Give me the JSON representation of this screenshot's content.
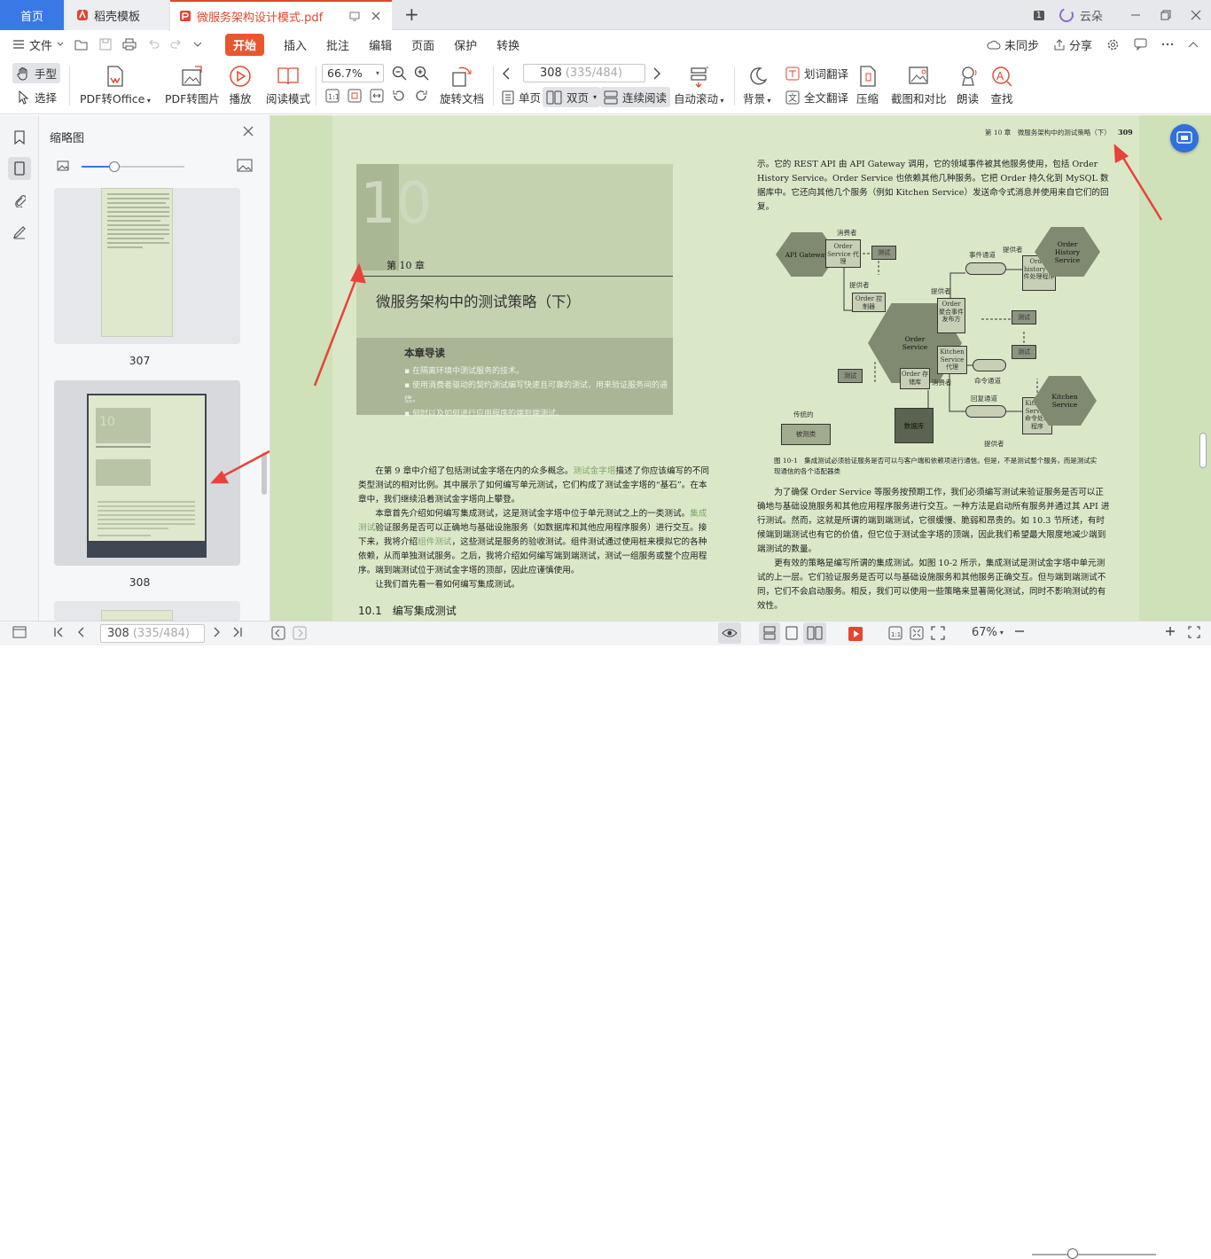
{
  "tabs": {
    "home": "首页",
    "template": "稻壳模板",
    "pdf": "微服务架构设计模式.pdf"
  },
  "window": {
    "page_badge": "1",
    "cloud_user": "云朵"
  },
  "menu": {
    "file": "文件",
    "items": [
      "开始",
      "插入",
      "批注",
      "编辑",
      "页面",
      "保护",
      "转换"
    ],
    "sync": "未同步",
    "share": "分享"
  },
  "ribbon": {
    "hand": "手型",
    "select": "选择",
    "pdf_to_office": "PDF转Office",
    "pdf_to_image": "PDF转图片",
    "play": "播放",
    "read_mode": "阅读模式",
    "zoom": "66.7%",
    "rotate": "旋转文档",
    "page_current": "308",
    "page_info": "(335/484)",
    "single": "单页",
    "double": "双页",
    "continuous": "连续阅读",
    "autoscroll": "自动滚动",
    "background": "背景",
    "word_translate": "划词翻译",
    "full_translate": "全文翻译",
    "compress": "压缩",
    "screenshot": "截图和对比",
    "read_aloud": "朗读",
    "find": "查找"
  },
  "thumbs": {
    "title": "缩略图",
    "pages": [
      "307",
      "308"
    ]
  },
  "doc": {
    "left": {
      "chapter_number": "10",
      "chapter_label": "第 10 章",
      "chapter_title": "微服务架构中的测试策略（下）",
      "guide_title": "本章导读",
      "guide_items": [
        "在隔离环境中测试服务的技术。",
        "使用消费者驱动的契约测试编写快速且可靠的测试，用来验证服务间的通信。",
        "何时以及如何进行应用程序的端到端测试。"
      ],
      "para1a": "在第 9 章中介绍了包括测试金字塔在内的众多概念。",
      "para1_link": "测试金字塔",
      "para1b": "描述了你应该编写的不同类型测试的相对比例。其中展示了如何编写单元测试，它们构成了测试金字塔的“基石”。在本章中，我们继续沿着测试金字塔向上攀登。",
      "para2a": "本章首先介绍如何编写集成测试，这是测试金字塔中位于单元测试之上的一类测试。",
      "para2_link": "集成测试",
      "para2b": "验证服务是否可以正确地与基础设施服务（如数据库和其他应用程序服务）进行交互。接下来，我将介绍",
      "para2_link2": "组件测试",
      "para2c": "，这些测试是服务的验收测试。组件测试通过使用桩来模拟它的各种依赖，从而单独测试服务。之后，我将介绍如何编写端到端测试，测试一组服务或整个应用程序。端到端测试位于测试金字塔的顶部，因此应谨慎使用。",
      "para3": "让我们首先看一看如何编写集成测试。",
      "section": "10.1　编写集成测试"
    },
    "right": {
      "header": "第 10 章　微服务架构中的测试策略（下）",
      "page_number": "309",
      "top_para": "示。它的 REST API 由 API Gateway 调用，它的领域事件被其他服务使用，包括 Order History Service。Order Service 也依赖其他几种服务。它把 Order 持久化到 MySQL 数据库中。它还向其他几个服务（例如 Kitchen Service）发送命令式消息并使用来自它们的回复。",
      "diagram": {
        "api_gateway": "API Gateway",
        "consumer": "消费者",
        "order_service_proxy": "Order Service 代理",
        "test": "测试",
        "event_channel": "事件通道",
        "provider": "提供者",
        "order_history_service": "Order History Service",
        "order_history_handler": "Order history 事件处理程序",
        "order_controller": "Order 控制器",
        "order_service": "Order Service",
        "order_aggregate_publisher": "Order 聚合事件发布方",
        "kitchen_service_proxy": "Kitchen Service 代理",
        "order_repository": "Order 存储库",
        "command_channel": "命令通道",
        "reply_channel": "回复通道",
        "kitchen_service": "Kitchen Service",
        "kitchen_command_handler": "Kitchen Service 命令处理程序",
        "database": "数据库",
        "legend_title": "传统的",
        "legend_box": "被测类"
      },
      "caption": "图 10-1　集成测试必须验证服务是否可以与客户端和依赖项进行通信。但是，不是测试整个服务，而是测试实现通信的各个适配器类",
      "para1": "为了确保 Order Service 等服务按预期工作，我们必须编写测试来验证服务是否可以正确地与基础设施服务和其他应用程序服务进行交互。一种方法是启动所有服务并通过其 API 进行测试。然而，这就是所谓的端到端测试，它很缓慢、脆弱和昂贵的。如 10.3 节所述，有时候端到端测试也有它的价值，但它位于测试金字塔的顶端，因此我们希望最大限度地减少端到端测试的数量。",
      "para2": "更有效的策略是编写所谓的集成测试。如图 10-2 所示，集成测试是测试金字塔中单元测试的上一层。它们验证服务是否可以与基础设施服务和其他服务正确交互。但与端到端测试不同，它们不会启动服务。相反，我们可以使用一些策略来显著简化测试，同时不影响测试的有效性。"
    }
  },
  "status": {
    "page_current": "308",
    "page_info": "(335/484)",
    "zoom": "67%"
  },
  "colors": {
    "accent": "#e9572e",
    "tab_home": "#3a78e6",
    "doc_bg": "#cfe1b8",
    "arrow": "#e8433a"
  }
}
